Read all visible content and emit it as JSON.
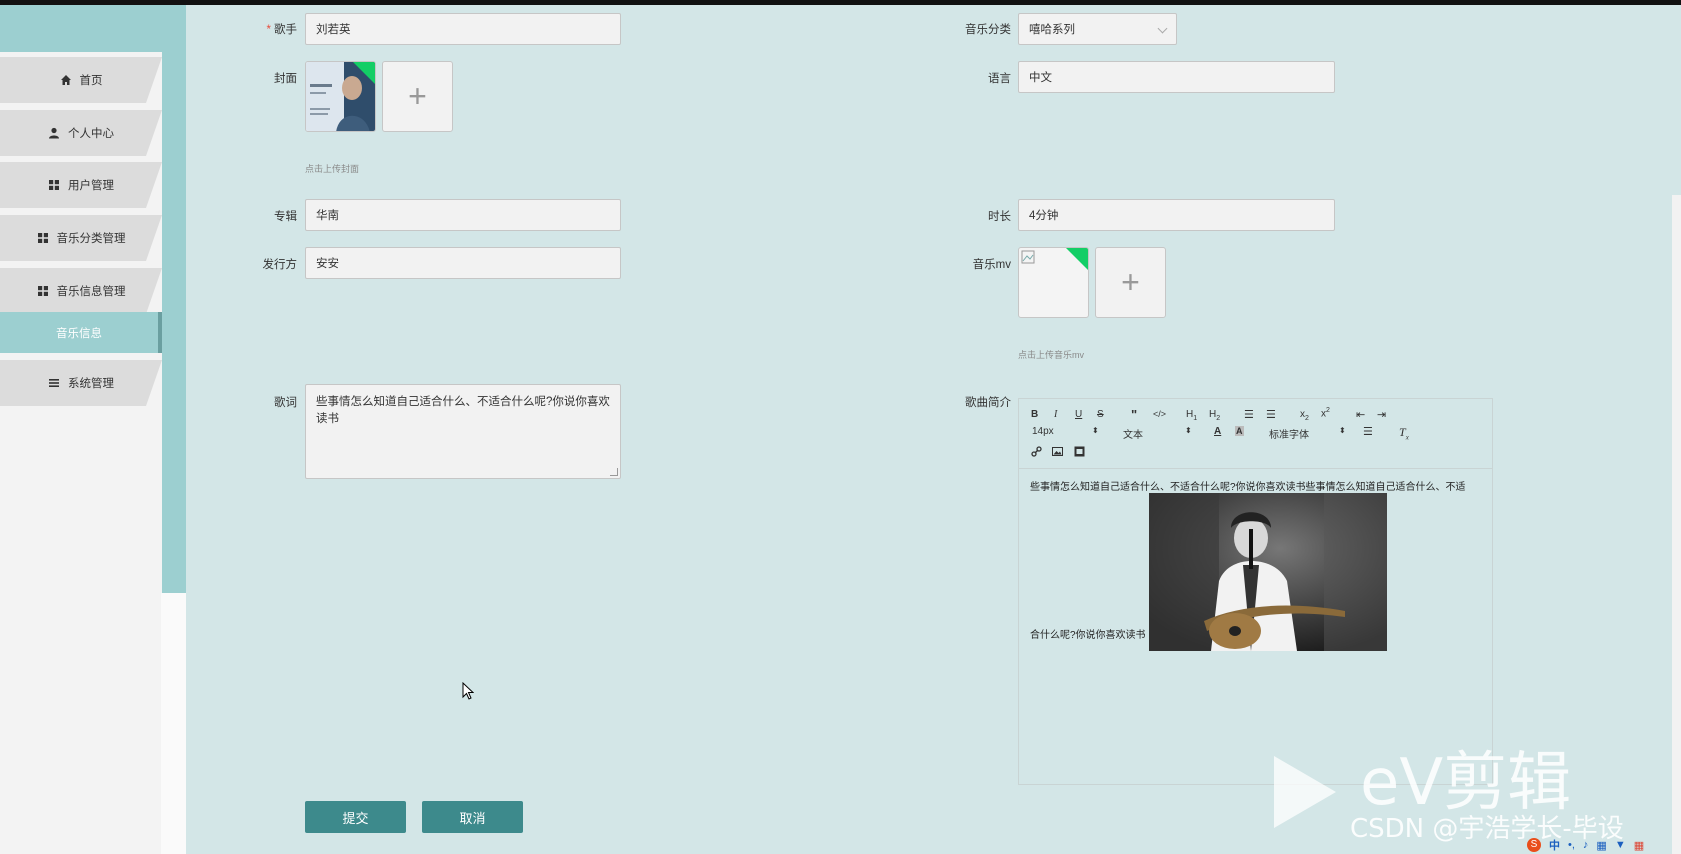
{
  "sidebar": {
    "items": [
      {
        "label": "首页",
        "icon": "home-icon"
      },
      {
        "label": "个人中心",
        "icon": "user-icon"
      },
      {
        "label": "用户管理",
        "icon": "grid-icon"
      },
      {
        "label": "音乐分类管理",
        "icon": "grid-icon"
      },
      {
        "label": "音乐信息管理",
        "icon": "grid-icon"
      },
      {
        "label": "音乐信息",
        "icon": ""
      },
      {
        "label": "系统管理",
        "icon": "list-icon"
      }
    ]
  },
  "form": {
    "singer": {
      "label": "歌手",
      "required_mark": "*",
      "value": "刘若英"
    },
    "category": {
      "label": "音乐分类",
      "value": "嘻哈系列"
    },
    "cover": {
      "label": "封面",
      "hint": "点击上传封面"
    },
    "language": {
      "label": "语言",
      "value": "中文"
    },
    "album": {
      "label": "专辑",
      "value": "华南"
    },
    "duration": {
      "label": "时长",
      "value": "4分钟"
    },
    "publisher": {
      "label": "发行方",
      "value": "安安"
    },
    "mv": {
      "label": "音乐mv",
      "hint": "点击上传音乐mv"
    },
    "lyrics": {
      "label": "歌词",
      "value": "些事情怎么知道自己适合什么、不适合什么呢?你说你喜欢读书"
    },
    "intro": {
      "label": "歌曲简介",
      "toolbar": {
        "font_size": "14px",
        "text_type": "文本",
        "font_family": "标准字体"
      },
      "content_line1": "些事情怎么知道自己适合什么、不适合什么呢?你说你喜欢读书些事情怎么知道自己适合什么、不适",
      "content_line2": "合什么呢?你说你喜欢读书"
    }
  },
  "buttons": {
    "submit": "提交",
    "cancel": "取消"
  },
  "watermark": {
    "brand": "eV剪辑",
    "credit": "CSDN @宇浩学长-毕设"
  },
  "tray": {
    "ime": "中"
  },
  "colors": {
    "accent": "#3d8a8c",
    "sidebar_active": "#9ccfd0",
    "background": "#d3e6e7",
    "upload_corner": "#13ce66",
    "required": "#e74c3c"
  }
}
